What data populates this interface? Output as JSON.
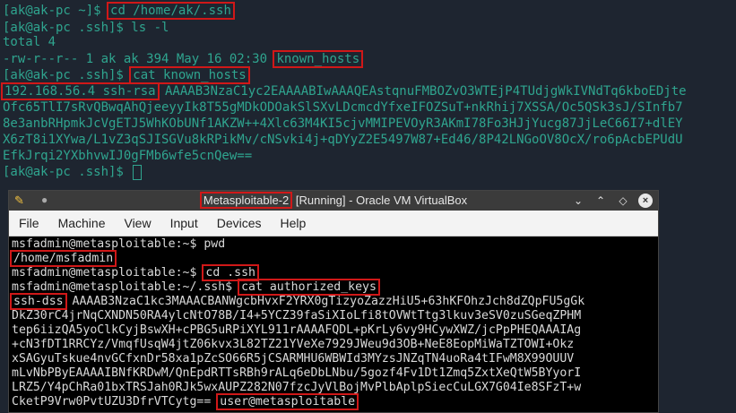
{
  "host_terminal": {
    "lines": {
      "cmd1_prompt": "[ak@ak-pc ~]$ ",
      "cmd1": "cd /home/ak/.ssh",
      "cmd2": "[ak@ak-pc .ssh]$ ls -l",
      "total": "total 4",
      "ls_entry_meta": "-rw-r--r-- 1 ak ak 394 May 16 02:30 ",
      "ls_entry_file": "known_hosts",
      "cmd3_prompt": "[ak@ak-pc .ssh]$ ",
      "cmd3": "cat known_hosts",
      "key_host": "192.168.56.4 ssh-rsa",
      "key_rest1": " AAAAB3NzaC1yc2EAAAABIwAAAQEAstqnuFMBOZvO3WTEjP4TUdjgWkIVNdTq6kboEDjte",
      "key_l2": "Ofc65TlI7sRvQBwqAhQjeeyyIk8T55gMDkODOakSlSXvLDcmcdYfxeIFOZSuT+nkRhij7XSSA/Oc5QSk3sJ/SInfb7",
      "key_l3": "8e3anbRHpmkJcVgETJ5WhKObUNf1AKZW++4Xlc63M4KI5cjvMMIPEVOyR3AKmI78Fo3HJjYucg87JjLeC66I7+dlEY",
      "key_l4": "X6zT8i1XYwa/L1vZ3qSJISGVu8kRPikMv/cNSvki4j+qDYyZ2E5497W87+Ed46/8P42LNGoOV8OcX/ro6pAcbEPUdU",
      "key_l5": "EfkJrqi2YXbhvwIJ0gFMb6wfe5cnQew==",
      "final_prompt": "[ak@ak-pc .ssh]$ "
    }
  },
  "vbox": {
    "title_box": "Metasploitable-2",
    "title_rest": " [Running] - Oracle VM VirtualBox",
    "menu": [
      "File",
      "Machine",
      "View",
      "Input",
      "Devices",
      "Help"
    ],
    "lines": {
      "c1": "msfadmin@metasploitable:~$ pwd",
      "pwd_out": "/home/msfadmin",
      "c2_prompt": "msfadmin@metasploitable:~$ ",
      "c2": "cd .ssh",
      "c3_prompt": "msfadmin@metasploitable:~/.ssh$ ",
      "c3": "cat authorized_keys",
      "k_type": "ssh-dss",
      "k1": " AAAAB3NzaC1kc3MAAACBANWgcbHvxF2YRX0gTizyoZazzHiU5+63hKFOhzJch8dZQpFU5gGk",
      "k2": "DkZ30rC4jrNqCXNDN50RA4ylcNtO78B/I4+5YCZ39faSiXIoLfi8tOVWtTtg3lkuv3eSV0zuSGeqZPHM",
      "k3": "tep6iizQA5yoClkCyjBswXH+cPBG5uRPiXYL911rAAAAFQDL+pKrLy6vy9HCywXWZ/jcPpPHEQAAAIAg",
      "k4": "+cN3fDT1RRCYz/VmqfUsqW4jtZ06kvx3L82TZ21YVeXe7929JWeu9d3OB+NeE8EopMiWaTZTOWI+Okz",
      "k5": "xSAGyuTskue4nvGCfxnDr58xa1pZcSO66R5jCSARMHU6WBWId3MYzsJNZqTN4uoRa4tIFwM8X99OUUV",
      "k6": "mLvNbPByEAAAAIBNfKRDwM/QnEpdRTTsRBh9rALq6eDbLNbu/5gozf4Fv1Dt1Zmq5ZxtXeQtW5BYyorI",
      "k7": "LRZ5/Y4pChRa01bxTRSJah0RJk5wxAUPZ282N07fzcJyVlBojMvPlbAplpSiecCuLGX7G04Ie8SFzT+w",
      "k8": "CketP9Vrw0PvtUZU3DfrVTCytg== ",
      "k_user": "user@metasploitable"
    }
  },
  "colors": {
    "host_text": "#2fa58f",
    "highlight_box": "#d01818",
    "vm_screen_bg": "#000000"
  }
}
